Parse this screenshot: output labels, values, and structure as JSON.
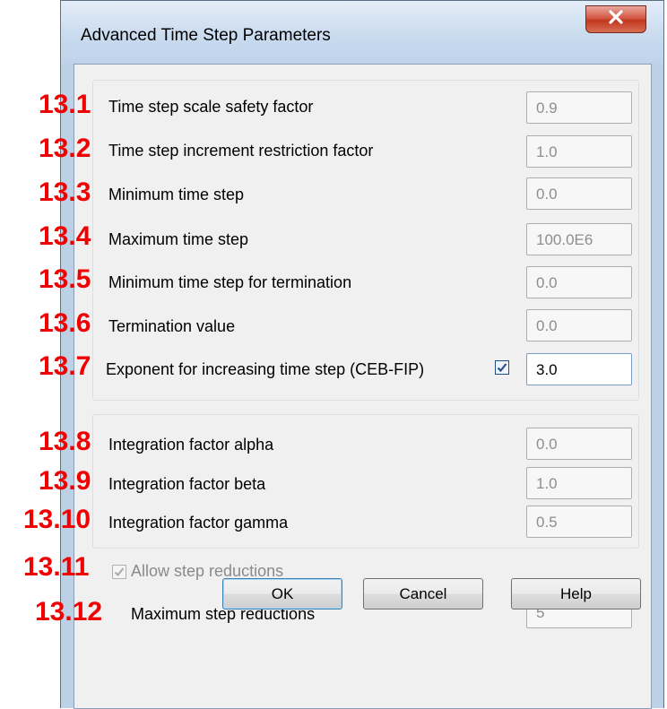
{
  "dialog": {
    "title": "Advanced Time Step Parameters",
    "close_label": "X"
  },
  "group1": [
    {
      "label": "Time step scale safety factor",
      "value": "0.9"
    },
    {
      "label": "Time step increment restriction factor",
      "value": "1.0"
    },
    {
      "label": "Minimum time step",
      "value": "0.0"
    },
    {
      "label": "Maximum time step",
      "value": "100.0E6"
    },
    {
      "label": "Minimum time step for termination",
      "value": "0.0"
    },
    {
      "label": "Termination value",
      "value": "0.0"
    },
    {
      "label": "Exponent for increasing time step (CEB-FIP)",
      "value": "3.0",
      "checked": true
    }
  ],
  "group2": [
    {
      "label": "Integration factor alpha",
      "value": "0.0"
    },
    {
      "label": "Integration factor beta",
      "value": "1.0"
    },
    {
      "label": "Integration factor gamma",
      "value": "0.5"
    }
  ],
  "allow_reductions": {
    "label": "Allow step reductions",
    "checked": true
  },
  "max_reductions": {
    "label": "Maximum step reductions",
    "value": "5"
  },
  "buttons": {
    "ok": "OK",
    "cancel": "Cancel",
    "help": "Help"
  },
  "markers": [
    "13.1",
    "13.2",
    "13.3",
    "13.4",
    "13.5",
    "13.6",
    "13.7",
    "13.8",
    "13.9",
    "13.10",
    "13.11",
    "13.12"
  ],
  "colors": {
    "marker": "#f00000",
    "titlebar": "#c8daee",
    "close_button": "#c2371f",
    "dialog_bg": "#f0f0f0"
  }
}
